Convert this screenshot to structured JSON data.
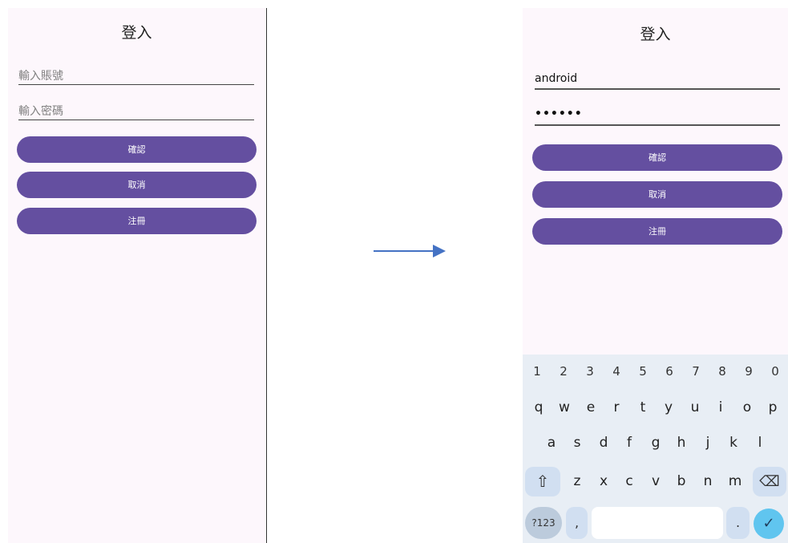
{
  "left": {
    "title": "登入",
    "account_placeholder": "輸入賬號",
    "password_placeholder": "輸入密碼",
    "confirm_label": "確認",
    "cancel_label": "取消",
    "register_label": "注冊"
  },
  "right": {
    "title": "登入",
    "account_value": "android",
    "password_value": "••••••",
    "confirm_label": "確認",
    "cancel_label": "取消",
    "register_label": "注冊"
  },
  "keyboard": {
    "numbers": [
      "1",
      "2",
      "3",
      "4",
      "5",
      "6",
      "7",
      "8",
      "9",
      "0"
    ],
    "row1": [
      "q",
      "w",
      "e",
      "r",
      "t",
      "y",
      "u",
      "i",
      "o",
      "p"
    ],
    "row2": [
      "a",
      "s",
      "d",
      "f",
      "g",
      "h",
      "j",
      "k",
      "l"
    ],
    "row3": [
      "z",
      "x",
      "c",
      "v",
      "b",
      "n",
      "m"
    ],
    "shift_icon": "⇧",
    "backspace_icon": "⌫",
    "symbols_label": "?123",
    "comma_label": ",",
    "period_label": ".",
    "enter_icon": "✓"
  },
  "colors": {
    "button_purple": "#644fa0",
    "screen_bg": "#fdf7fc",
    "arrow_blue": "#4472c4",
    "enter_blue": "#60c5ef"
  }
}
